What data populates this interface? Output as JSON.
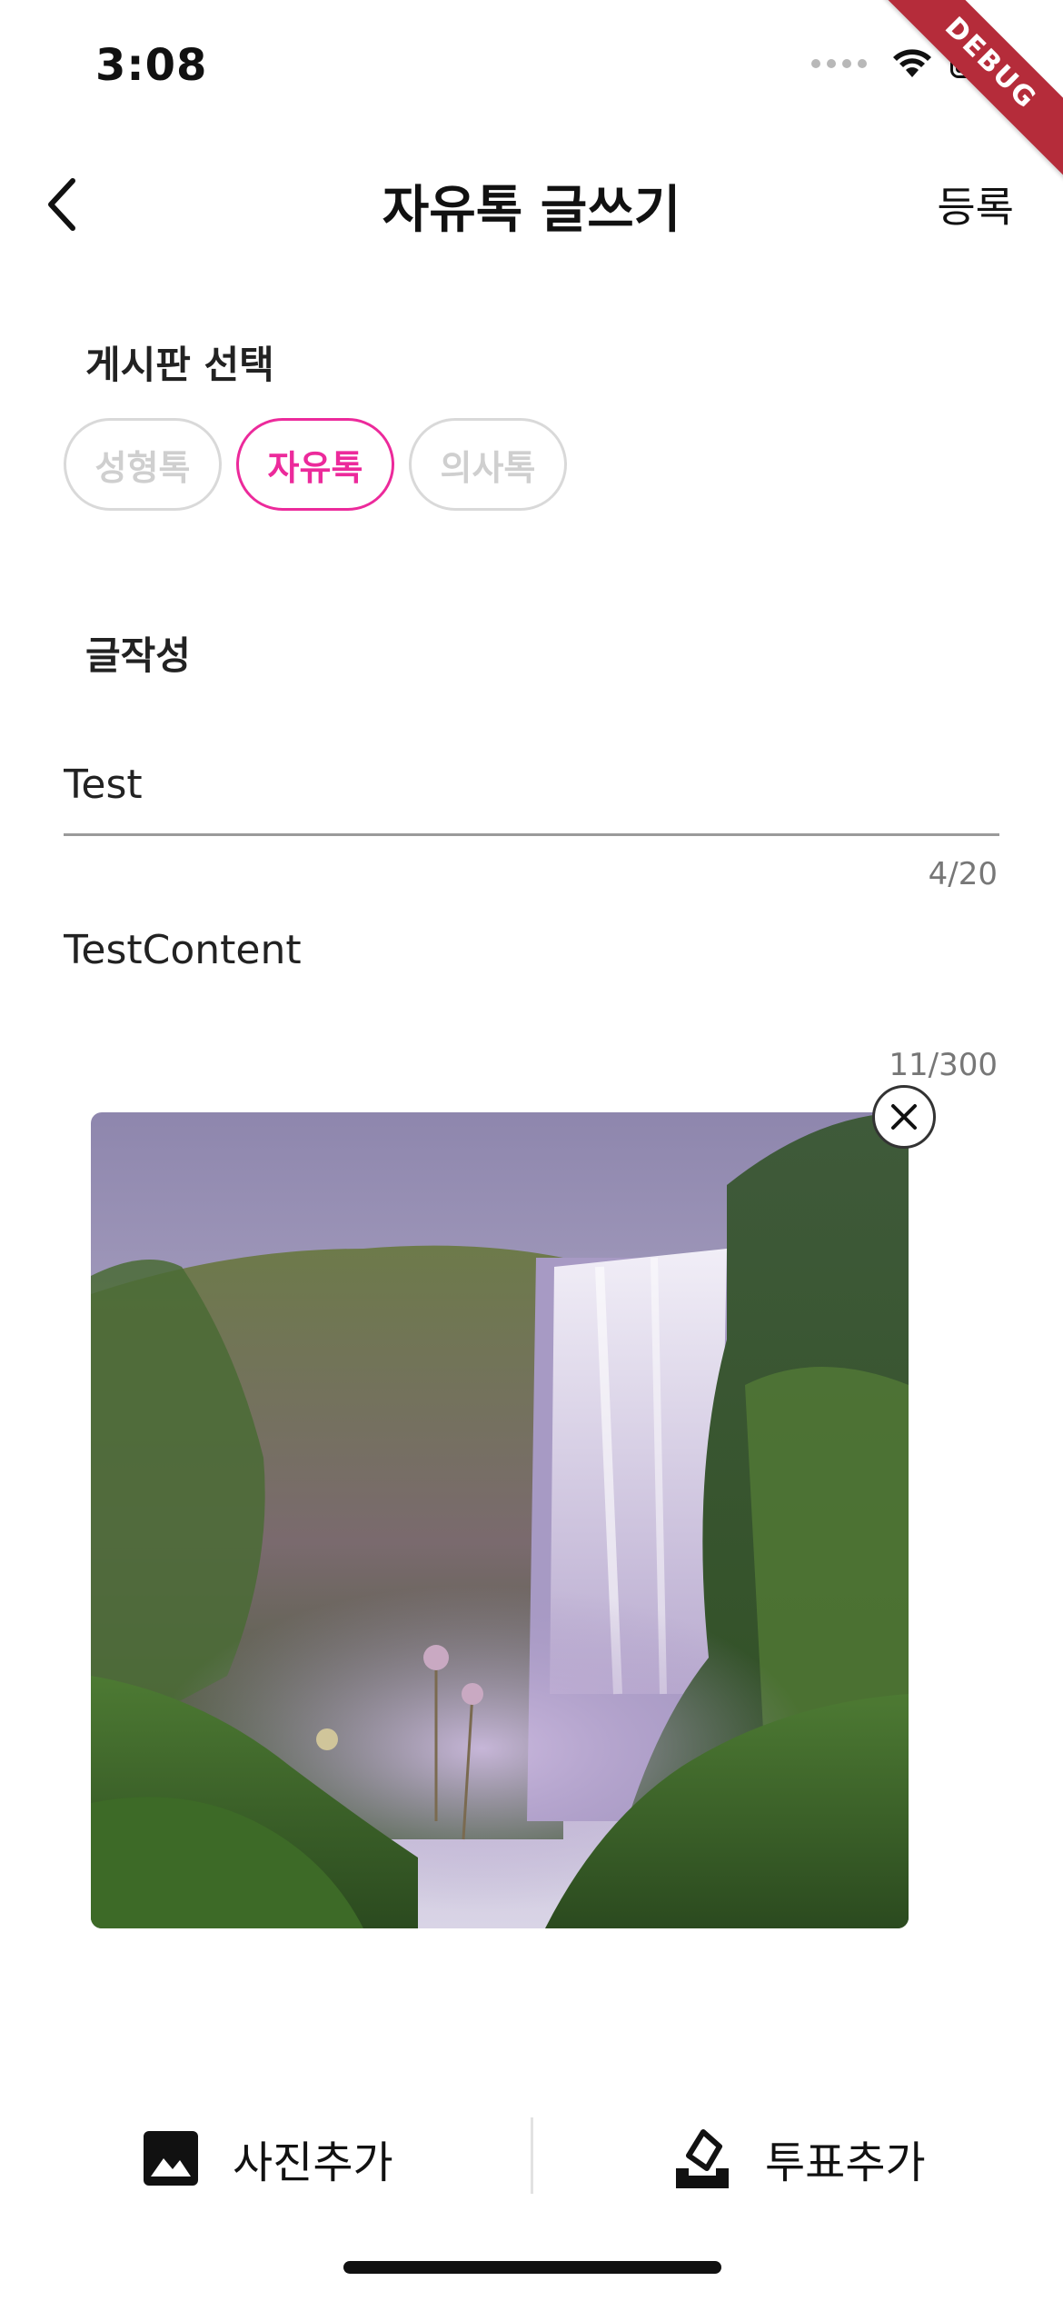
{
  "status_bar": {
    "time": "3:08"
  },
  "debug_banner": "DEBUG",
  "header": {
    "title": "자유톡 글쓰기",
    "submit_label": "등록"
  },
  "board_section": {
    "label": "게시판 선택",
    "options": [
      {
        "label": "성형톡",
        "selected": false
      },
      {
        "label": "자유톡",
        "selected": true
      },
      {
        "label": "의사톡",
        "selected": false
      }
    ]
  },
  "compose_section": {
    "label": "글작성",
    "title_value": "Test",
    "title_counter": "4/20",
    "content_value": "TestContent",
    "content_counter": "11/300"
  },
  "bottom_bar": {
    "add_photo_label": "사진추가",
    "add_poll_label": "투표추가"
  },
  "colors": {
    "accent": "#ec2a9b",
    "chip_border": "#d9d9d9",
    "chip_text": "#cfcfcf"
  }
}
